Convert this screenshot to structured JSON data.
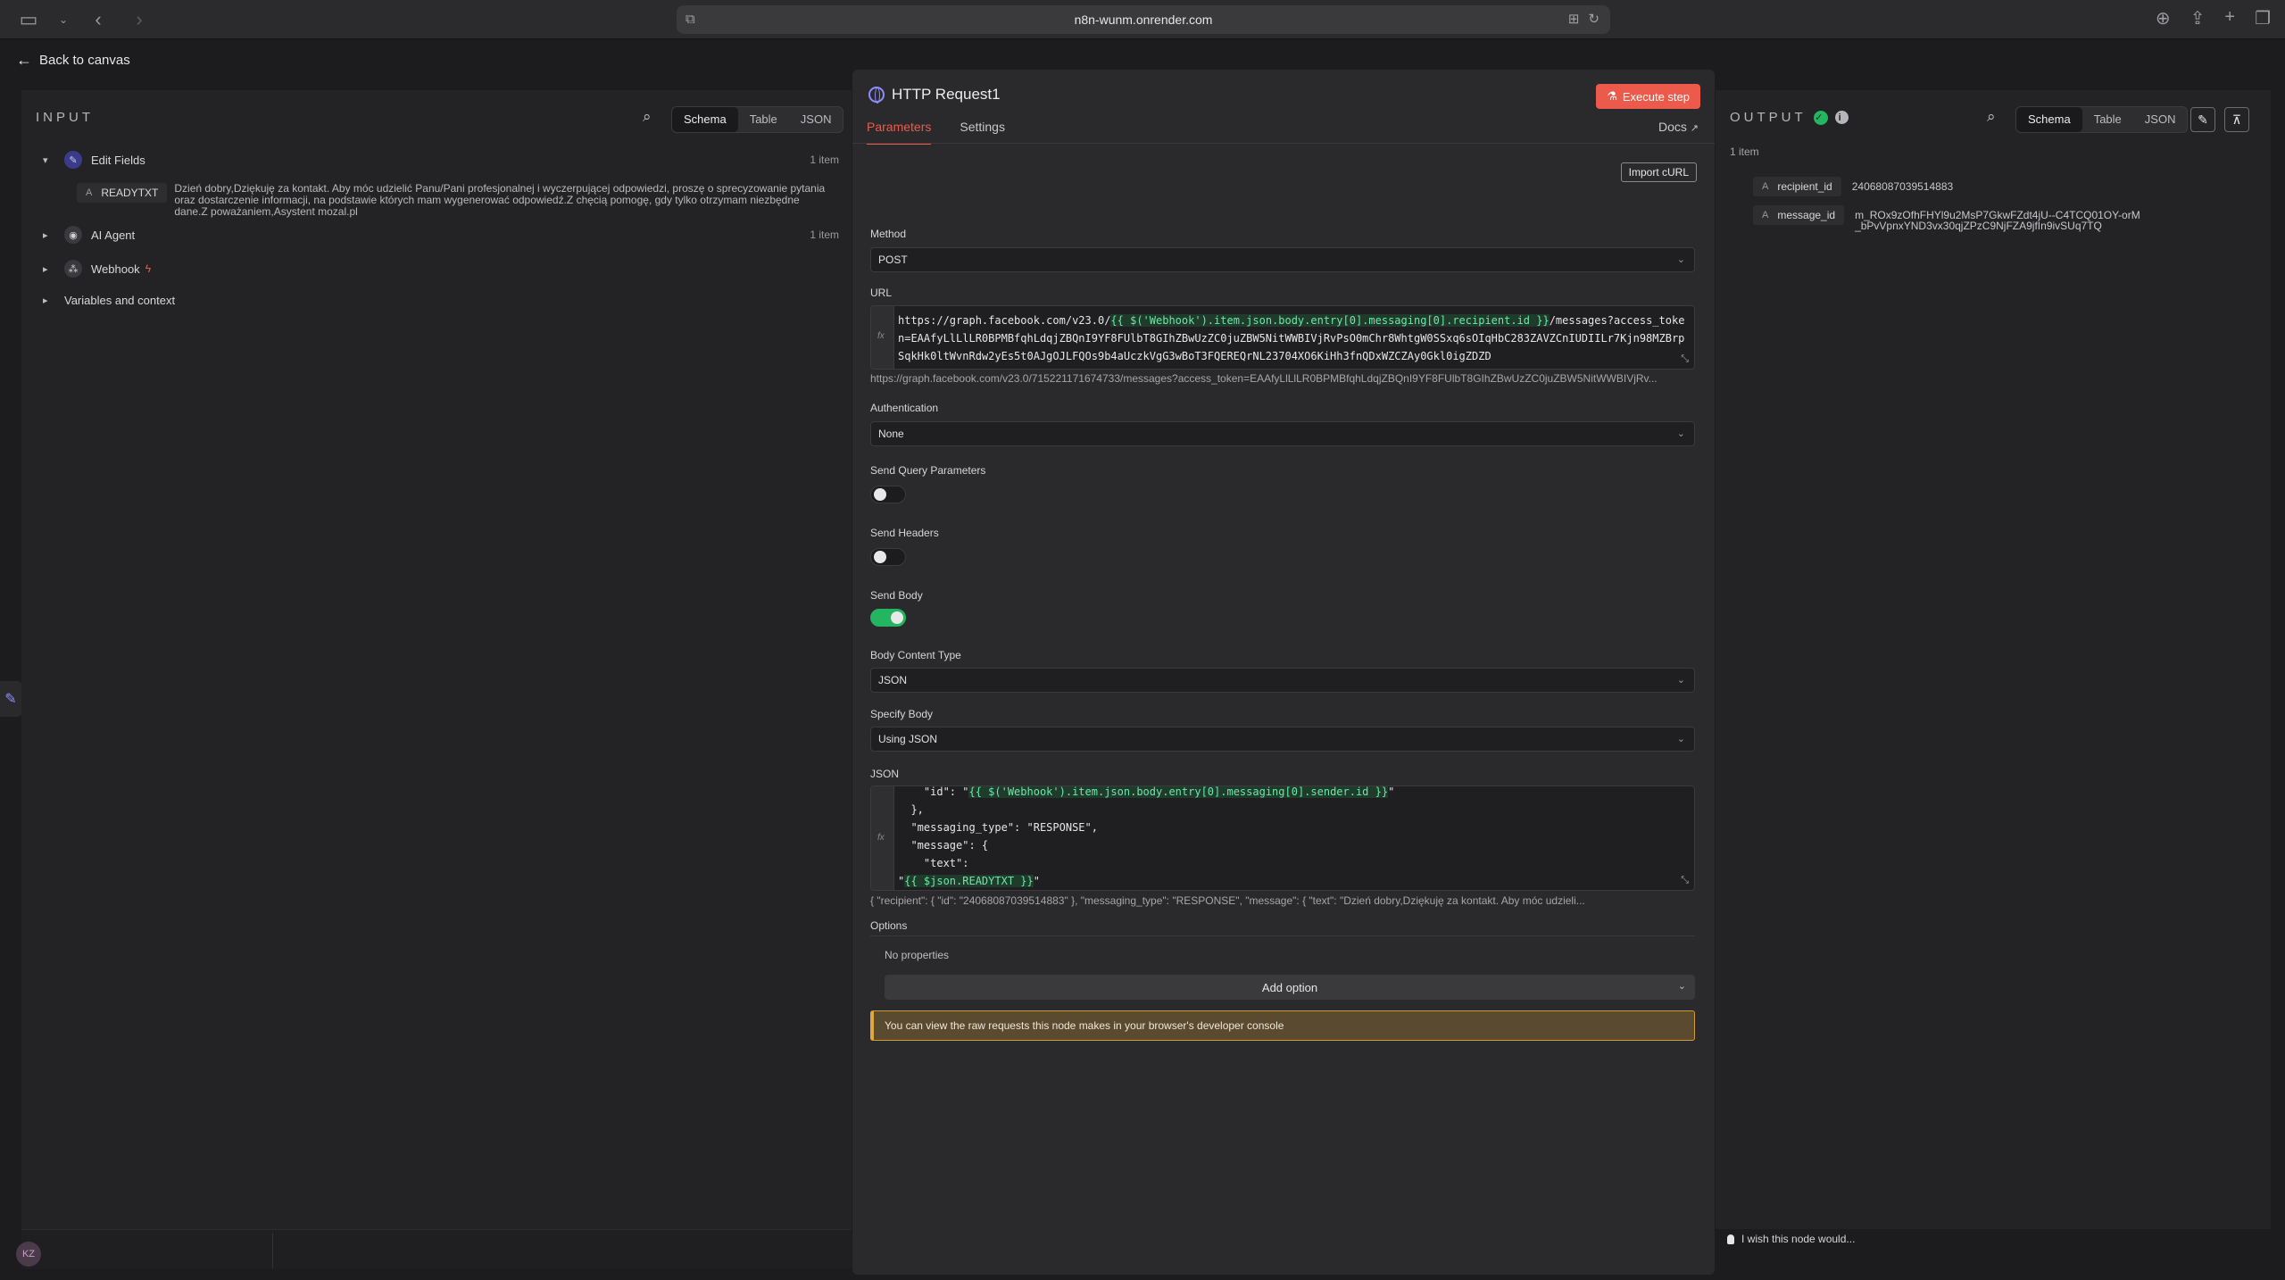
{
  "browser": {
    "url": "n8n-wunm.onrender.com"
  },
  "app": {
    "back_label": "Back to canvas"
  },
  "input_panel": {
    "title": "INPUT",
    "views": [
      "Schema",
      "Table",
      "JSON"
    ],
    "active_view": "Schema",
    "nodes": [
      {
        "label": "Edit Fields",
        "count": "1 item",
        "expanded": true
      },
      {
        "label": "AI Agent",
        "count": "1 item",
        "expanded": false
      },
      {
        "label": "Webhook",
        "count": "",
        "expanded": false
      },
      {
        "label": "Variables and context",
        "count": "",
        "expanded": false
      }
    ],
    "field": {
      "type": "A",
      "key": "READYTXT",
      "value": "Dzień dobry,Dziękuję za kontakt. Aby móc udzielić Panu/Pani profesjonalnej i wyczerpującej odpowiedzi, proszę o sprecyzowanie pytania oraz dostarczenie informacji, na podstawie których mam wygenerować odpowiedź.Z chęcią pomogę, gdy tylko otrzymam niezbędne dane.Z poważaniem,Asystent mozal.pl"
    }
  },
  "modal": {
    "title": "HTTP Request1",
    "execute_label": "Execute step",
    "tabs": [
      "Parameters",
      "Settings"
    ],
    "active_tab": "Parameters",
    "docs_label": "Docs",
    "import_curl_label": "Import cURL",
    "method": {
      "label": "Method",
      "value": "POST"
    },
    "url": {
      "label": "URL",
      "prefix": "https://graph.facebook.com/v23.0/",
      "expression": "{{ $('Webhook').item.json.body.entry[0].messaging[0].recipient.id }}",
      "suffix": "/messages?access_token=EAAfyLlLlLR0BPMBfqhLdqjZBQnI9YF8FUlbT8GIhZBwUzZC0juZBW5NitWWBIVjRvPsO0mChr8WhtgW0SSxq6sOIqHbC283ZAVZCnIUDIILr7Kjn98MZBrpSqkHk0ltWvnRdw2yEs5t0AJgOJLFQOs9b4aUczkVgG3wBoT3FQEREQrNL23704XO6KiHh3fnQDxWZCZAy0Gkl0igZDZD",
      "preview": "https://graph.facebook.com/v23.0/715221171674733/messages?access_token=EAAfyLlLlLR0BPMBfqhLdqjZBQnI9YF8FUlbT8GIhZBwUzZC0juZBW5NitWWBIVjRv..."
    },
    "authentication": {
      "label": "Authentication",
      "value": "None"
    },
    "send_query": {
      "label": "Send Query Parameters",
      "on": false
    },
    "send_headers": {
      "label": "Send Headers",
      "on": false
    },
    "send_body": {
      "label": "Send Body",
      "on": true
    },
    "body_content_type": {
      "label": "Body Content Type",
      "value": "JSON"
    },
    "specify_body": {
      "label": "Specify Body",
      "value": "Using JSON"
    },
    "json": {
      "label": "JSON",
      "line1_prefix": "    \"id\": \"",
      "line1_expr": "{{ $('Webhook').item.json.body.entry[0].messaging[0].sender.id }}",
      "line1_suffix": "\"",
      "line2": "  },",
      "line3": "  \"messaging_type\": \"RESPONSE\",",
      "line4": "  \"message\": {",
      "line5": "    \"text\":",
      "line6_prefix": "\"",
      "line6_expr": "{{ $json.READYTXT }}",
      "line6_suffix": "\"",
      "preview": "{   \"recipient\": {     \"id\": \"24068087039514883\"   },   \"messaging_type\": \"RESPONSE\",   \"message\": {     \"text\": \"Dzień dobry,Dziękuję za kontakt. Aby móc udzieli..."
    },
    "options": {
      "label": "Options",
      "empty_label": "No properties",
      "add_label": "Add option"
    },
    "notice": "You can view the raw requests this node makes in your browser's developer console"
  },
  "output_panel": {
    "title": "OUTPUT",
    "views": [
      "Schema",
      "Table",
      "JSON"
    ],
    "active_view": "Schema",
    "count": "1 item",
    "fields": [
      {
        "type": "A",
        "key": "recipient_id",
        "value": "24068087039514883"
      },
      {
        "type": "A",
        "key": "message_id",
        "value": "m_ROx9zOfhFHYl9u2MsP7GkwFZdt4jU--C4TCQ01OY-orM_bPvVpnxYND3vx30qjZPzC9NjFZA9jfIn9ivSUq7TQ"
      }
    ],
    "wish_label": "I wish this node would..."
  },
  "user": {
    "avatar_initials": "KZ"
  },
  "colors": {
    "accent": "#ec5a4b",
    "success": "#23b55f",
    "expression": "#6ee7a7"
  }
}
